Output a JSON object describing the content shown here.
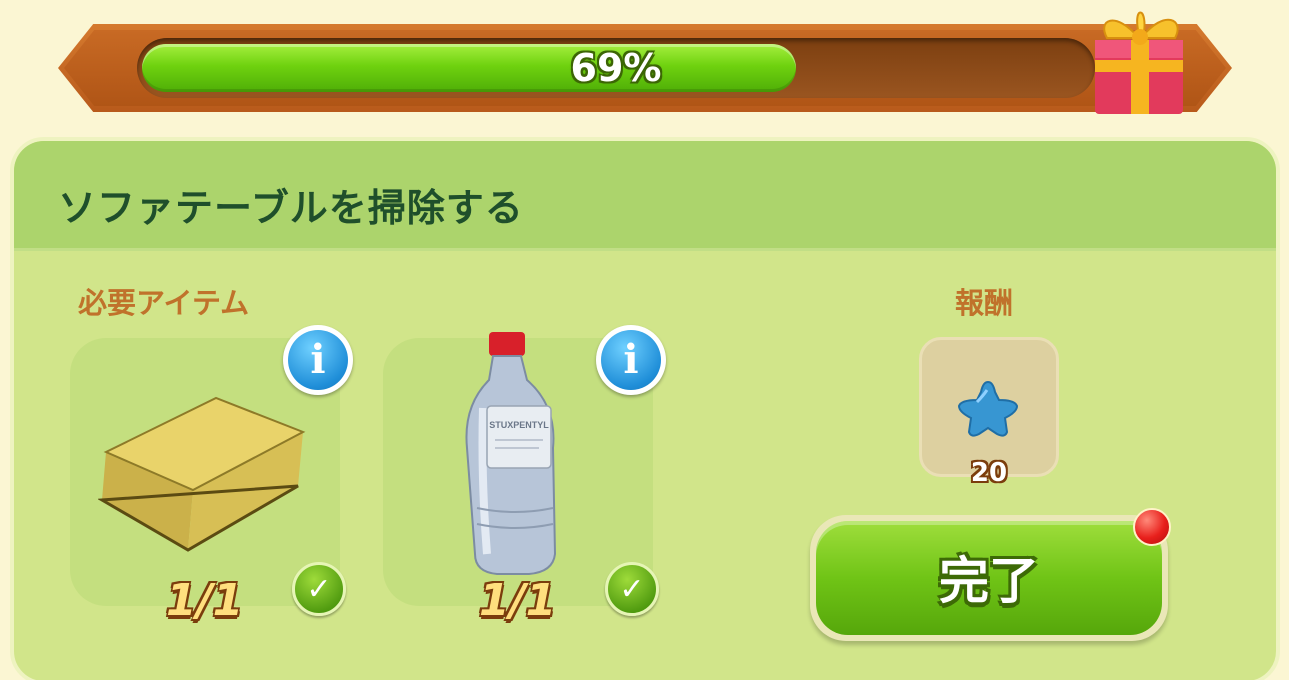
{
  "progress": {
    "percent_value": 0.69,
    "label": "69%"
  },
  "task": {
    "title": "ソファテーブルを掃除する"
  },
  "required_items": {
    "label": "必要アイテム",
    "items": [
      {
        "name": "sponge",
        "count": "1/1",
        "info": "i"
      },
      {
        "name": "cleaner-bottle",
        "count": "1/1",
        "info": "i",
        "bottle_label": "STUXPENTYL"
      }
    ]
  },
  "reward": {
    "label": "報酬",
    "icon": "blue-star-icon",
    "value": "20"
  },
  "complete_button": {
    "label": "完了"
  },
  "colors": {
    "panel": "#d1e58a",
    "header": "#acd46c",
    "title_text": "#1f4f2b",
    "section_label": "#c0722b",
    "progress_fill": "#6fd20f",
    "button_green": "#70c416"
  }
}
